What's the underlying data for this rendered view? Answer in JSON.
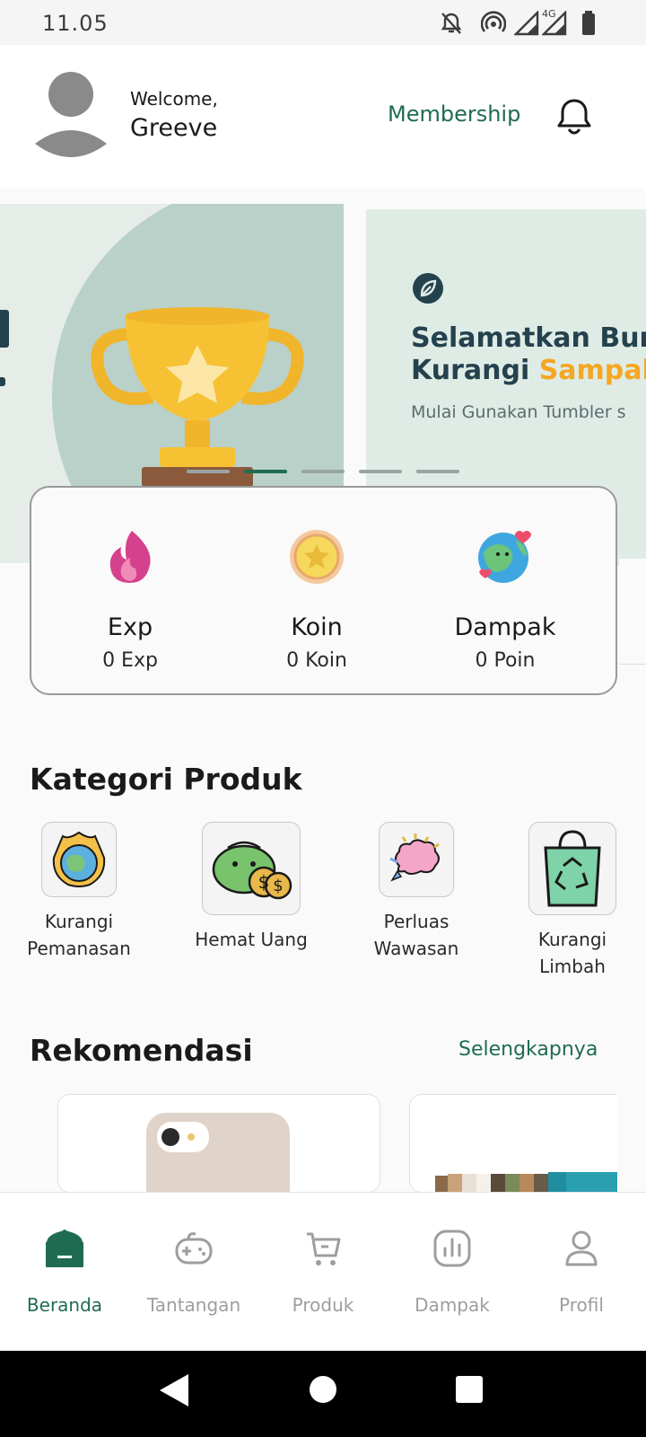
{
  "status_bar": {
    "time": "11.05",
    "network": "4G",
    "icons": [
      "mute-icon",
      "hotspot-icon",
      "signal-icon",
      "signal-4g-icon",
      "battery-icon"
    ]
  },
  "header": {
    "welcome": "Welcome,",
    "username": "Greeve",
    "membership": "Membership",
    "icons": [
      "avatar-icon",
      "bell-icon"
    ]
  },
  "carousel": {
    "slide_2": {
      "title_line_1": "Selamatkan Bum",
      "title_line_2_part_1": "Kurangi ",
      "title_line_2_highlight": "Sampah",
      "subtitle": "Mulai Gunakan Tumbler s"
    },
    "active_index": 1,
    "slide_count": 5
  },
  "stats": [
    {
      "label": "Exp",
      "value": "0 Exp",
      "icon": "flame-icon"
    },
    {
      "label": "Koin",
      "value": "0 Koin",
      "icon": "coin-icon"
    },
    {
      "label": "Dampak",
      "value": "0 Poin",
      "icon": "earth-icon"
    }
  ],
  "kategori": {
    "title": "Kategori Produk",
    "items": [
      {
        "label": "Kurangi\nPemanasan",
        "icon": "earth-flame-icon"
      },
      {
        "label": "Hemat Uang",
        "icon": "wallet-coins-icon"
      },
      {
        "label": "Perluas\nWawasan",
        "icon": "brain-icon"
      },
      {
        "label": "Kurangi\nLimbah",
        "icon": "recycle-bag-icon"
      }
    ]
  },
  "rekomendasi": {
    "title": "Rekomendasi",
    "more": "Selengkapnya"
  },
  "bottom_nav": {
    "items": [
      {
        "label": "Beranda",
        "icon": "home-icon",
        "active": true
      },
      {
        "label": "Tantangan",
        "icon": "gamepad-icon",
        "active": false
      },
      {
        "label": "Produk",
        "icon": "cart-icon",
        "active": false
      },
      {
        "label": "Dampak",
        "icon": "chart-icon",
        "active": false
      },
      {
        "label": "Profil",
        "icon": "user-icon",
        "active": false
      }
    ]
  },
  "colors": {
    "primary": "#1f6b51",
    "accent": "#f5a623",
    "navy": "#24414e"
  }
}
